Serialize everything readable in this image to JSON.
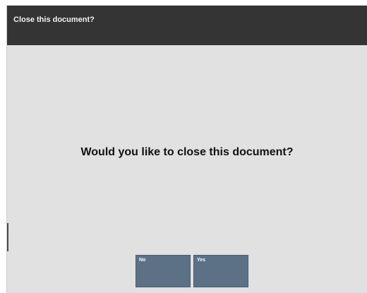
{
  "dialog": {
    "title": "Close this document?",
    "prompt": "Would you like to close this document?"
  },
  "buttons": {
    "no_label": "No",
    "yes_label": "Yes"
  },
  "colors": {
    "title_bar": "#343434",
    "background": "#e1e1e1",
    "button": "#5d7186"
  }
}
